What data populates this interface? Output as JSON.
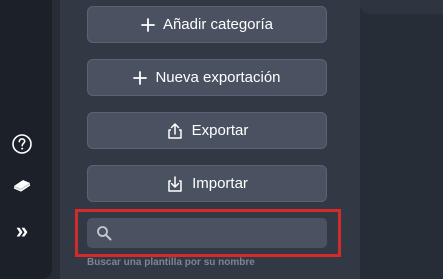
{
  "sidebar": {
    "icons": [
      {
        "name": "help-icon"
      },
      {
        "name": "book-icon"
      },
      {
        "name": "expand-icon",
        "glyph": "»"
      }
    ]
  },
  "panel": {
    "buttons": [
      {
        "label": "Añadir categoría",
        "icon": "plus-icon"
      },
      {
        "label": "Nueva exportación",
        "icon": "plus-icon"
      },
      {
        "label": "Exportar",
        "icon": "export-icon"
      },
      {
        "label": "Importar",
        "icon": "import-icon"
      }
    ],
    "search": {
      "value": "",
      "placeholder": "",
      "hint": "Buscar una plantilla por su nombre"
    }
  },
  "colors": {
    "highlight": "#d32a2a",
    "button_bg": "#4a5261",
    "panel_bg": "#323944"
  }
}
